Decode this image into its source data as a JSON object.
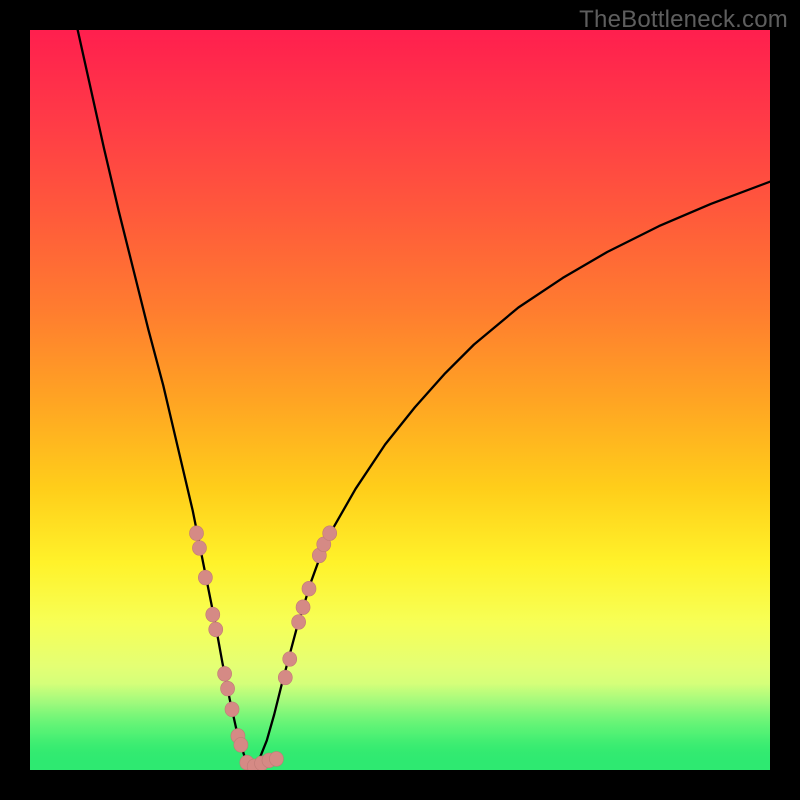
{
  "watermark": "TheBottleneck.com",
  "colors": {
    "frame_bg": "#000000",
    "curve": "#000000",
    "marker_fill": "#d58a85",
    "marker_stroke": "#c07b76",
    "good_band_core": "#2ee971",
    "gradient_stops": [
      {
        "offset": 0.0,
        "color": "#ff1f4e"
      },
      {
        "offset": 0.12,
        "color": "#ff3a47"
      },
      {
        "offset": 0.25,
        "color": "#ff5a3b"
      },
      {
        "offset": 0.38,
        "color": "#ff7d2f"
      },
      {
        "offset": 0.5,
        "color": "#ffa423"
      },
      {
        "offset": 0.62,
        "color": "#ffce1a"
      },
      {
        "offset": 0.72,
        "color": "#fff22a"
      },
      {
        "offset": 0.8,
        "color": "#f7ff56"
      },
      {
        "offset": 0.86,
        "color": "#e4ff74"
      },
      {
        "offset": 0.91,
        "color": "#c3ff80"
      },
      {
        "offset": 0.95,
        "color": "#8dff7a"
      },
      {
        "offset": 0.975,
        "color": "#4df26f"
      },
      {
        "offset": 1.0,
        "color": "#2ee971"
      }
    ],
    "green_overlay_stops": [
      {
        "offset": 0.0,
        "color": "rgba(46,233,113,0)"
      },
      {
        "offset": 0.5,
        "color": "rgba(46,233,113,0.55)"
      },
      {
        "offset": 1.0,
        "color": "rgba(46,233,113,1)"
      }
    ]
  },
  "chart_data": {
    "type": "line",
    "title": "",
    "xlabel": "",
    "ylabel": "",
    "xlim": [
      0,
      100
    ],
    "ylim": [
      0,
      100
    ],
    "optimum_x": 30,
    "left_curve": [
      {
        "x": 6.0,
        "y": 102.0
      },
      {
        "x": 8.0,
        "y": 93.0
      },
      {
        "x": 10.0,
        "y": 84.0
      },
      {
        "x": 12.0,
        "y": 75.5
      },
      {
        "x": 14.0,
        "y": 67.5
      },
      {
        "x": 16.0,
        "y": 59.5
      },
      {
        "x": 18.0,
        "y": 52.0
      },
      {
        "x": 20.0,
        "y": 43.5
      },
      {
        "x": 22.0,
        "y": 35.0
      },
      {
        "x": 23.0,
        "y": 30.0
      },
      {
        "x": 24.0,
        "y": 25.0
      },
      {
        "x": 25.0,
        "y": 20.0
      },
      {
        "x": 26.0,
        "y": 14.5
      },
      {
        "x": 27.0,
        "y": 9.5
      },
      {
        "x": 28.0,
        "y": 5.0
      },
      {
        "x": 29.0,
        "y": 1.8
      },
      {
        "x": 30.0,
        "y": 0.3
      }
    ],
    "right_curve": [
      {
        "x": 30.0,
        "y": 0.3
      },
      {
        "x": 31.0,
        "y": 1.5
      },
      {
        "x": 32.0,
        "y": 4.0
      },
      {
        "x": 33.0,
        "y": 7.5
      },
      {
        "x": 34.0,
        "y": 11.5
      },
      {
        "x": 36.0,
        "y": 19.0
      },
      {
        "x": 38.0,
        "y": 25.5
      },
      {
        "x": 40.0,
        "y": 31.0
      },
      {
        "x": 44.0,
        "y": 38.0
      },
      {
        "x": 48.0,
        "y": 44.0
      },
      {
        "x": 52.0,
        "y": 49.0
      },
      {
        "x": 56.0,
        "y": 53.5
      },
      {
        "x": 60.0,
        "y": 57.5
      },
      {
        "x": 66.0,
        "y": 62.5
      },
      {
        "x": 72.0,
        "y": 66.5
      },
      {
        "x": 78.0,
        "y": 70.0
      },
      {
        "x": 85.0,
        "y": 73.5
      },
      {
        "x": 92.0,
        "y": 76.5
      },
      {
        "x": 100.0,
        "y": 79.5
      }
    ],
    "markers_left": [
      {
        "x": 22.5,
        "y": 32.0
      },
      {
        "x": 22.9,
        "y": 30.0
      },
      {
        "x": 23.7,
        "y": 26.0
      },
      {
        "x": 24.7,
        "y": 21.0
      },
      {
        "x": 25.1,
        "y": 19.0
      },
      {
        "x": 26.3,
        "y": 13.0
      },
      {
        "x": 26.7,
        "y": 11.0
      },
      {
        "x": 27.3,
        "y": 8.2
      },
      {
        "x": 28.1,
        "y": 4.6
      },
      {
        "x": 28.5,
        "y": 3.4
      }
    ],
    "markers_bottom": [
      {
        "x": 29.3,
        "y": 1.0
      },
      {
        "x": 30.3,
        "y": 0.5
      },
      {
        "x": 31.3,
        "y": 0.9
      },
      {
        "x": 32.3,
        "y": 1.3
      },
      {
        "x": 33.3,
        "y": 1.5
      }
    ],
    "markers_right": [
      {
        "x": 34.5,
        "y": 12.5
      },
      {
        "x": 35.1,
        "y": 15.0
      },
      {
        "x": 36.3,
        "y": 20.0
      },
      {
        "x": 36.9,
        "y": 22.0
      },
      {
        "x": 37.7,
        "y": 24.5
      },
      {
        "x": 39.1,
        "y": 29.0
      },
      {
        "x": 39.7,
        "y": 30.5
      },
      {
        "x": 40.5,
        "y": 32.0
      }
    ],
    "marker_r": 0.95,
    "good_band_y": [
      0,
      2.2
    ]
  }
}
